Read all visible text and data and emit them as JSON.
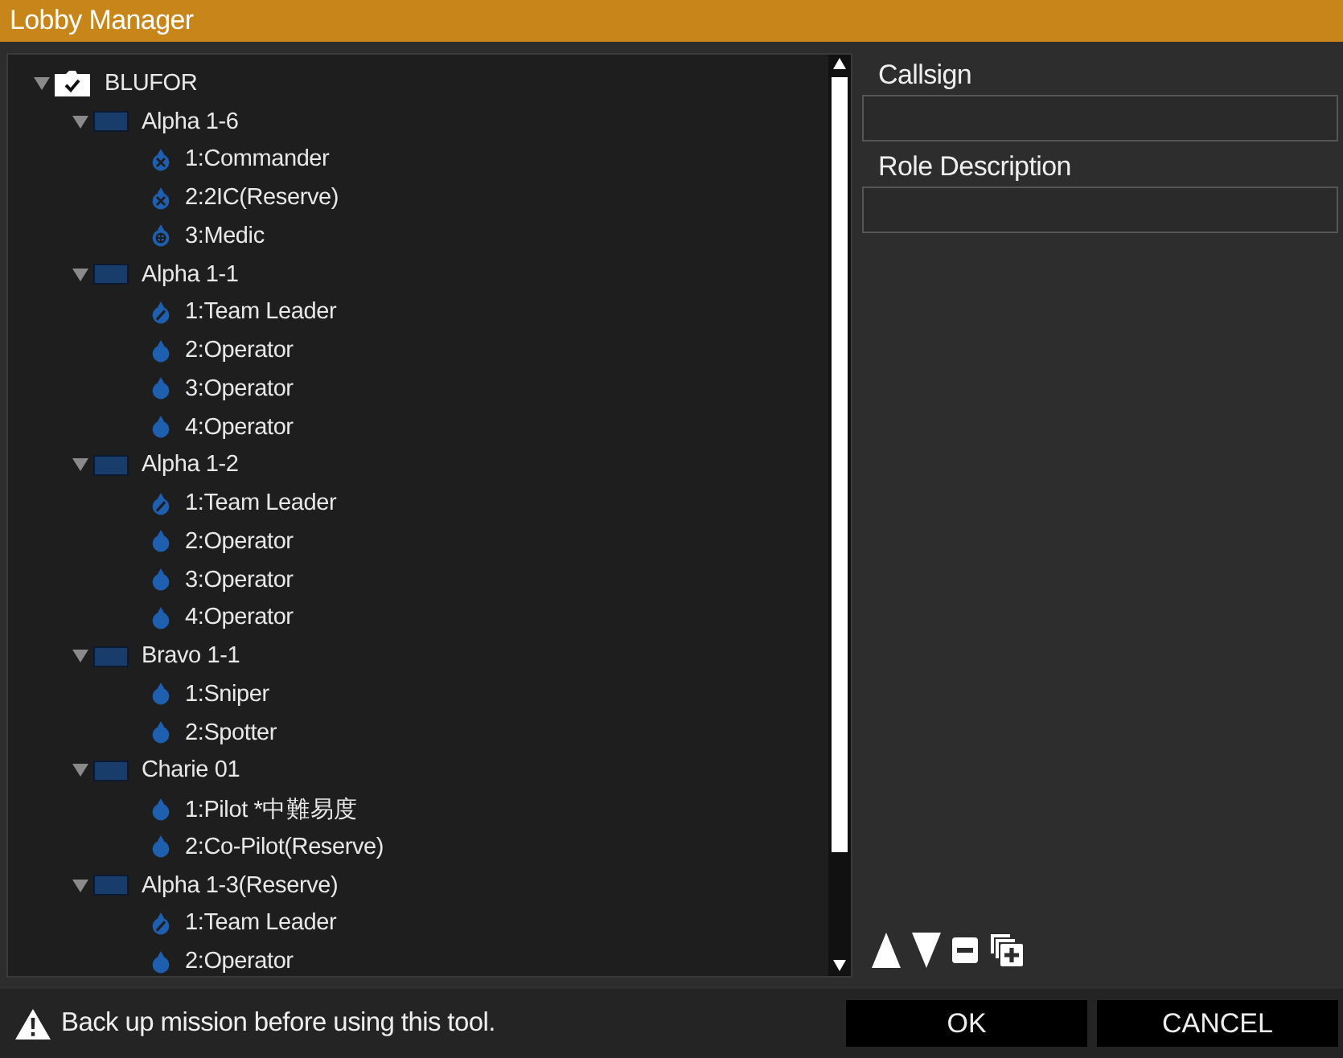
{
  "window": {
    "title": "Lobby Manager"
  },
  "tree": {
    "label": "BLUFOR",
    "expanded": true,
    "checked": true,
    "children": [
      {
        "label": "Alpha 1-6",
        "expanded": true,
        "children": [
          {
            "label": "1:Commander",
            "kind": "officer"
          },
          {
            "label": "2:2IC(Reserve)",
            "kind": "officer"
          },
          {
            "label": "3:Medic",
            "kind": "medic"
          }
        ]
      },
      {
        "label": "Alpha 1-1",
        "expanded": true,
        "children": [
          {
            "label": "1:Team Leader",
            "kind": "leader"
          },
          {
            "label": "2:Operator",
            "kind": "rifleman"
          },
          {
            "label": "3:Operator",
            "kind": "rifleman"
          },
          {
            "label": "4:Operator",
            "kind": "rifleman"
          }
        ]
      },
      {
        "label": "Alpha 1-2",
        "expanded": true,
        "children": [
          {
            "label": "1:Team Leader",
            "kind": "leader"
          },
          {
            "label": "2:Operator",
            "kind": "rifleman"
          },
          {
            "label": "3:Operator",
            "kind": "rifleman"
          },
          {
            "label": "4:Operator",
            "kind": "rifleman"
          }
        ]
      },
      {
        "label": "Bravo 1-1",
        "expanded": true,
        "children": [
          {
            "label": "1:Sniper",
            "kind": "rifleman"
          },
          {
            "label": "2:Spotter",
            "kind": "rifleman"
          }
        ]
      },
      {
        "label": "Charie 01",
        "expanded": true,
        "children": [
          {
            "label": "1:Pilot *中難易度",
            "kind": "rifleman"
          },
          {
            "label": "2:Co-Pilot(Reserve)",
            "kind": "rifleman"
          }
        ]
      },
      {
        "label": "Alpha 1-3(Reserve)",
        "expanded": true,
        "children": [
          {
            "label": "1:Team Leader",
            "kind": "leader"
          },
          {
            "label": "2:Operator",
            "kind": "rifleman"
          }
        ]
      }
    ]
  },
  "fields": [
    {
      "label": "Callsign"
    },
    {
      "label": "Role Description"
    }
  ],
  "warning": "Back up mission before using this tool.",
  "buttons": [
    "OK",
    "CANCEL"
  ]
}
